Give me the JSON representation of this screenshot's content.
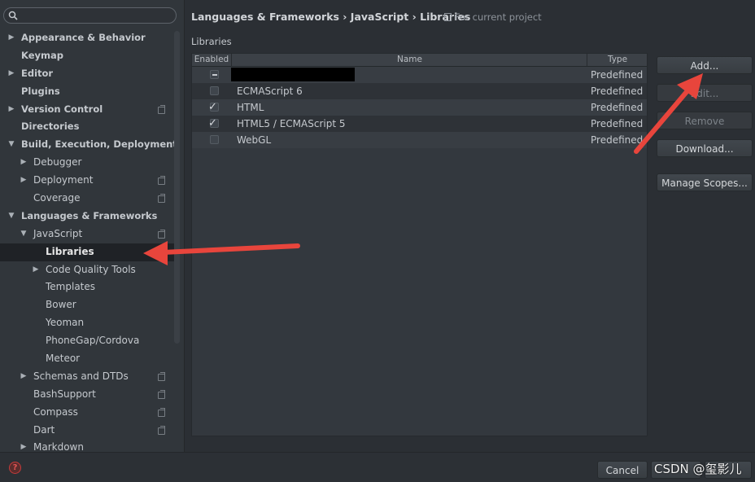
{
  "search": {
    "placeholder": ""
  },
  "sidebar": {
    "items": [
      {
        "label": "Appearance & Behavior",
        "level": 0,
        "arrow": "right",
        "bold": true
      },
      {
        "label": "Keymap",
        "level": 0,
        "arrow": "",
        "bold": true
      },
      {
        "label": "Editor",
        "level": 0,
        "arrow": "right",
        "bold": true
      },
      {
        "label": "Plugins",
        "level": 0,
        "arrow": "",
        "bold": true
      },
      {
        "label": "Version Control",
        "level": 0,
        "arrow": "right",
        "bold": true,
        "project": true
      },
      {
        "label": "Directories",
        "level": 0,
        "arrow": "",
        "bold": true
      },
      {
        "label": "Build, Execution, Deployment",
        "level": 0,
        "arrow": "down",
        "bold": true
      },
      {
        "label": "Debugger",
        "level": 1,
        "arrow": "right"
      },
      {
        "label": "Deployment",
        "level": 1,
        "arrow": "right",
        "project": true
      },
      {
        "label": "Coverage",
        "level": 1,
        "arrow": "",
        "project": true
      },
      {
        "label": "Languages & Frameworks",
        "level": 0,
        "arrow": "down",
        "bold": true
      },
      {
        "label": "JavaScript",
        "level": 1,
        "arrow": "down",
        "project": true
      },
      {
        "label": "Libraries",
        "level": 2,
        "arrow": "",
        "selected": true
      },
      {
        "label": "Code Quality Tools",
        "level": 2,
        "arrow": "right"
      },
      {
        "label": "Templates",
        "level": 2,
        "arrow": ""
      },
      {
        "label": "Bower",
        "level": 2,
        "arrow": ""
      },
      {
        "label": "Yeoman",
        "level": 2,
        "arrow": ""
      },
      {
        "label": "PhoneGap/Cordova",
        "level": 2,
        "arrow": ""
      },
      {
        "label": "Meteor",
        "level": 2,
        "arrow": ""
      },
      {
        "label": "Schemas and DTDs",
        "level": 1,
        "arrow": "right",
        "project": true
      },
      {
        "label": "BashSupport",
        "level": 1,
        "arrow": "",
        "project": true
      },
      {
        "label": "Compass",
        "level": 1,
        "arrow": "",
        "project": true
      },
      {
        "label": "Dart",
        "level": 1,
        "arrow": "",
        "project": true
      },
      {
        "label": "Markdown",
        "level": 1,
        "arrow": "right"
      }
    ]
  },
  "header": {
    "breadcrumb": "Languages & Frameworks › JavaScript › Libraries",
    "scope_note": "For current project"
  },
  "libraries": {
    "section_label": "Libraries",
    "columns": {
      "enabled": "Enabled",
      "name": "Name",
      "type": "Type"
    },
    "rows": [
      {
        "name": "",
        "type": "Predefined",
        "state": "partial",
        "redacted": true
      },
      {
        "name": "ECMAScript 6",
        "type": "Predefined",
        "state": "unchecked"
      },
      {
        "name": "HTML",
        "type": "Predefined",
        "state": "checked"
      },
      {
        "name": "HTML5 / ECMAScript 5",
        "type": "Predefined",
        "state": "checked"
      },
      {
        "name": "WebGL",
        "type": "Predefined",
        "state": "unchecked"
      }
    ]
  },
  "buttons": {
    "add": "Add...",
    "edit": "Edit...",
    "remove": "Remove",
    "download": "Download...",
    "manage_scopes": "Manage Scopes..."
  },
  "footer": {
    "help": "?",
    "cancel": "Cancel",
    "watermark": "CSDN @玺影儿"
  },
  "colors": {
    "arrow": "#e8453c",
    "accent": "#2b2f34"
  }
}
